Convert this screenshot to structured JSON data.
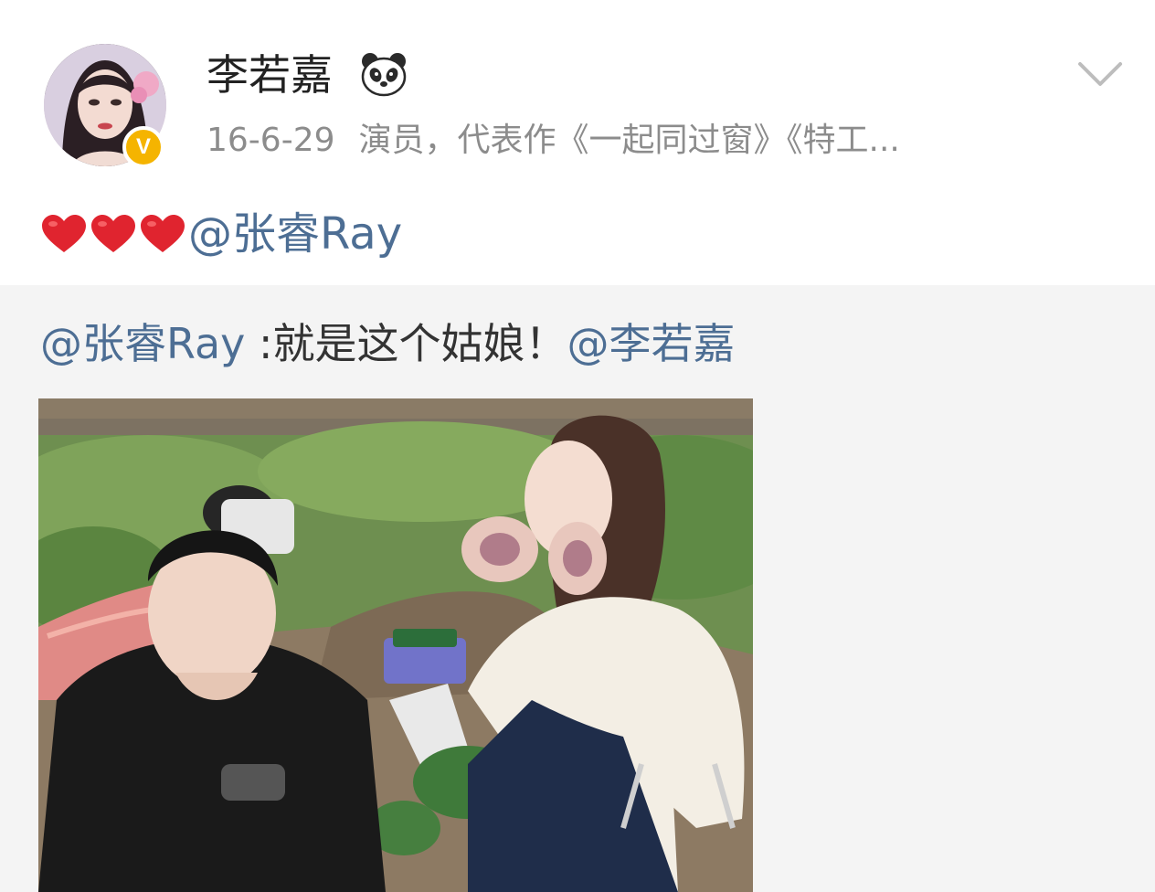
{
  "user": {
    "name": "李若嘉",
    "verified_mark": "V",
    "badge_icon": "panda-icon"
  },
  "meta": {
    "date": "16-6-29",
    "bio": "演员，代表作《一起同过窗》《特工..."
  },
  "post": {
    "hearts": [
      "❤",
      "❤",
      "❤"
    ],
    "mention": "@张睿Ray"
  },
  "repost": {
    "mention_author": "@张睿Ray",
    "text": " :就是这个姑娘！",
    "mention_target": "@李若嘉"
  },
  "colors": {
    "mention": "#4d6e94",
    "name": "#222222",
    "meta": "#8c8c8c",
    "verified": "#f5b400",
    "heart": "#e0242f",
    "repost_bg": "#f4f4f4"
  }
}
